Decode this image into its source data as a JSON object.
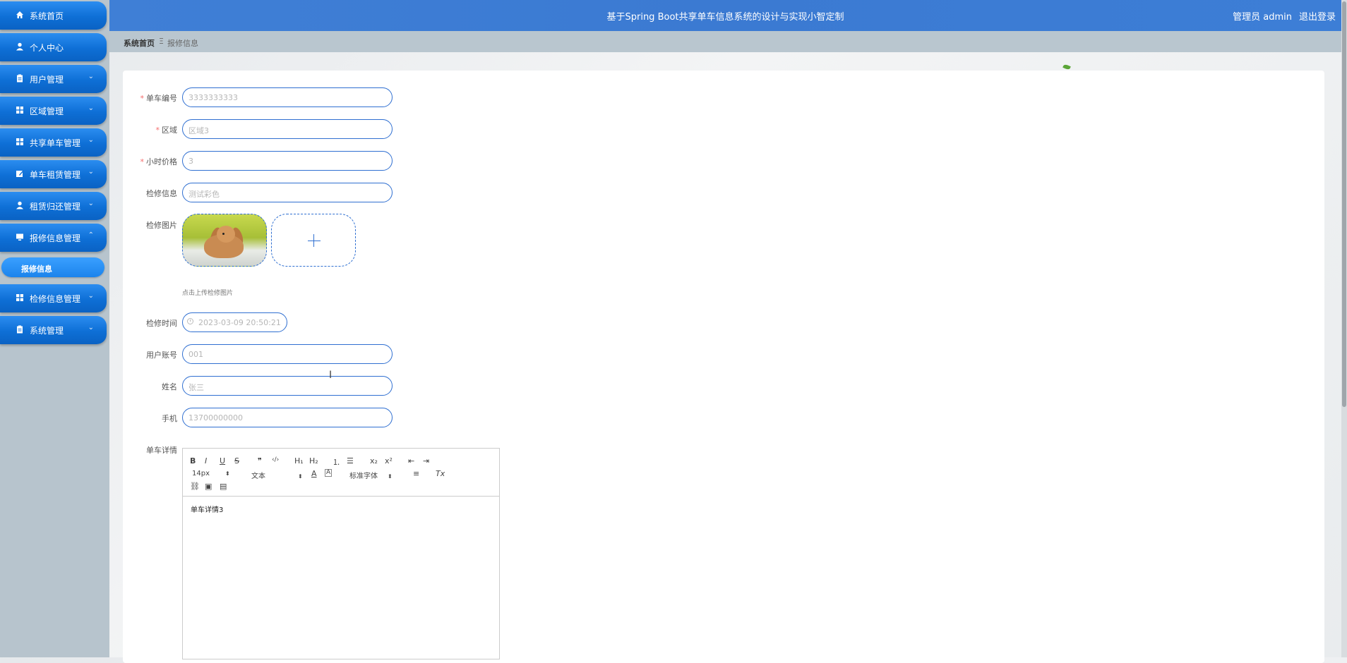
{
  "app": {
    "title": "基于Spring Boot共享单车信息系统的设计与实现小智定制",
    "user": "管理员 admin",
    "logout": "退出登录"
  },
  "sidebar": {
    "items": [
      {
        "label": "系统首页",
        "icon": "home-icon"
      },
      {
        "label": "个人中心",
        "icon": "user-icon"
      },
      {
        "label": "用户管理",
        "icon": "clipboard-icon"
      },
      {
        "label": "区域管理",
        "icon": "grid-icon"
      },
      {
        "label": "共享单车管理",
        "icon": "grid-icon"
      },
      {
        "label": "单车租赁管理",
        "icon": "edit-icon"
      },
      {
        "label": "租赁归还管理",
        "icon": "user-icon"
      },
      {
        "label": "报修信息管理",
        "icon": "monitor-icon"
      },
      {
        "label": "检修信息管理",
        "icon": "grid-icon"
      },
      {
        "label": "系统管理",
        "icon": "clipboard-icon"
      }
    ],
    "sub_item": "报修信息",
    "arrow_down": "⌄",
    "arrow_up": "⌃"
  },
  "breadcrumb": {
    "home": "系统首页",
    "separator": "Ξ",
    "current": "报修信息"
  },
  "form": {
    "bike_no": {
      "label": "单车编号",
      "value": "3333333333"
    },
    "area": {
      "label": "区域",
      "value": "区域3"
    },
    "hour_price": {
      "label": "小时价格",
      "value": "3"
    },
    "inspection_info": {
      "label": "检修信息",
      "value": "测试彩色"
    },
    "inspection_image": {
      "label": "检修图片",
      "hint": "点击上传检修图片"
    },
    "inspection_time": {
      "label": "检修时间",
      "value": "2023-03-09 20:50:21"
    },
    "user_account": {
      "label": "用户账号",
      "value": "001"
    },
    "name": {
      "label": "姓名",
      "value": "张三"
    },
    "phone": {
      "label": "手机",
      "value": "13700000000"
    },
    "bike_details": {
      "label": "单车详情",
      "content": "单车详情3"
    }
  },
  "editor": {
    "bold": "B",
    "italic": "I",
    "underline": "U",
    "strike": "S",
    "quote": "❞",
    "code": "‹/›",
    "h1": "H₁",
    "h2": "H₂",
    "ordered_list": "⒈",
    "bullet_list": "☰",
    "sub": "x₂",
    "sup": "x²",
    "outdent": "⇤",
    "indent": "⇥",
    "size": "14px",
    "header": "文本",
    "color": "A",
    "background": "A",
    "font": "标准字体",
    "align": "≡",
    "clean": "Tx",
    "link": "⛓",
    "image": "▣",
    "video": "▤",
    "caret": "⬍"
  },
  "colors": {
    "header_bg": "#3d7ed6",
    "menu_bg": "#0e6fd6",
    "sidebar_bg": "#b7c4cd",
    "input_border": "#2f6fd1",
    "required": "#f56c6c"
  }
}
